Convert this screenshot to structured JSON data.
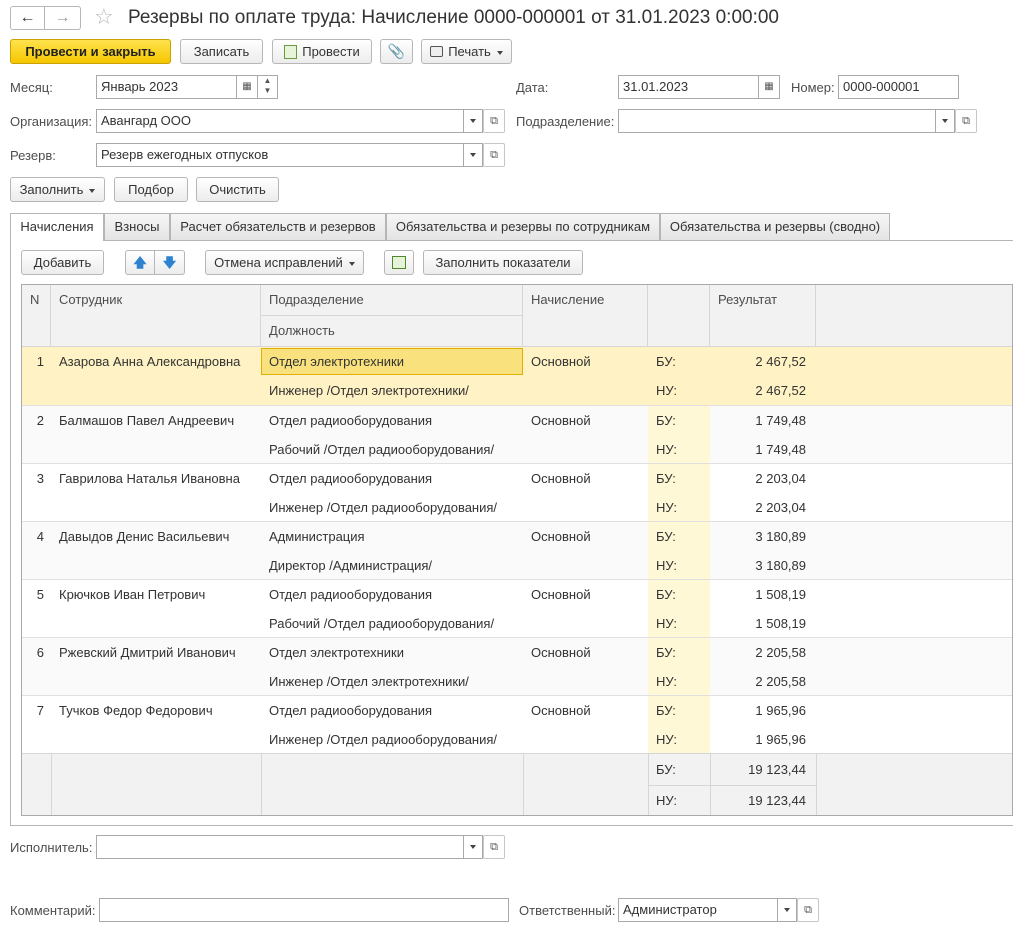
{
  "window": {
    "title": "Резервы по оплате труда: Начисление 0000-000001 от 31.01.2023 0:00:00"
  },
  "toolbar": {
    "post_close": "Провести и закрыть",
    "save": "Записать",
    "post": "Провести",
    "print": "Печать"
  },
  "form": {
    "month_label": "Месяц:",
    "month_value": "Январь 2023",
    "date_label": "Дата:",
    "date_value": "31.01.2023",
    "number_label": "Номер:",
    "number_value": "0000-000001",
    "org_label": "Организация:",
    "org_value": "Авангард ООО",
    "division_label": "Подразделение:",
    "division_value": "",
    "reserve_label": "Резерв:",
    "reserve_value": "Резерв ежегодных отпусков"
  },
  "actions": {
    "fill": "Заполнить",
    "select": "Подбор",
    "clear": "Очистить"
  },
  "tabs": [
    {
      "label": "Начисления"
    },
    {
      "label": "Взносы"
    },
    {
      "label": "Расчет обязательств и резервов"
    },
    {
      "label": "Обязательства и резервы по сотрудникам"
    },
    {
      "label": "Обязательства и резервы (сводно)"
    }
  ],
  "table_toolbar": {
    "add": "Добавить",
    "cancel_fix": "Отмена исправлений",
    "fill_indicators": "Заполнить показатели"
  },
  "table": {
    "headers": {
      "n": "N",
      "employee": "Сотрудник",
      "division": "Подразделение",
      "position": "Должность",
      "accrual": "Начисление",
      "result": "Результат"
    },
    "bu_label": "БУ:",
    "nu_label": "НУ:",
    "rows": [
      {
        "n": "1",
        "employee": "Азарова Анна Александровна",
        "division": "Отдел электротехники",
        "position": "Инженер /Отдел электротехники/",
        "accrual": "Основной",
        "bu": "2 467,52",
        "nu": "2 467,52"
      },
      {
        "n": "2",
        "employee": "Балмашов Павел Андреевич",
        "division": "Отдел радиооборудования",
        "position": "Рабочий /Отдел радиооборудования/",
        "accrual": "Основной",
        "bu": "1 749,48",
        "nu": "1 749,48"
      },
      {
        "n": "3",
        "employee": "Гаврилова Наталья Ивановна",
        "division": "Отдел радиооборудования",
        "position": "Инженер /Отдел радиооборудования/",
        "accrual": "Основной",
        "bu": "2 203,04",
        "nu": "2 203,04"
      },
      {
        "n": "4",
        "employee": "Давыдов Денис Васильевич",
        "division": "Администрация",
        "position": "Директор /Администрация/",
        "accrual": "Основной",
        "bu": "3 180,89",
        "nu": "3 180,89"
      },
      {
        "n": "5",
        "employee": "Крючков Иван Петрович",
        "division": "Отдел радиооборудования",
        "position": "Рабочий /Отдел радиооборудования/",
        "accrual": "Основной",
        "bu": "1 508,19",
        "nu": "1 508,19"
      },
      {
        "n": "6",
        "employee": "Ржевский Дмитрий Иванович",
        "division": "Отдел электротехники",
        "position": "Инженер /Отдел электротехники/",
        "accrual": "Основной",
        "bu": "2 205,58",
        "nu": "2 205,58"
      },
      {
        "n": "7",
        "employee": "Тучков Федор Федорович",
        "division": "Отдел радиооборудования",
        "position": "Инженер /Отдел радиооборудования/",
        "accrual": "Основной",
        "bu": "1 965,96",
        "nu": "1 965,96"
      }
    ],
    "totals": {
      "bu": "19 123,44",
      "nu": "19 123,44"
    }
  },
  "footer": {
    "executor_label": "Исполнитель:",
    "executor_value": "",
    "comment_label": "Комментарий:",
    "comment_value": "",
    "responsible_label": "Ответственный:",
    "responsible_value": "Администратор"
  },
  "colors": {
    "primary_button": "#f5c600",
    "selected_row": "#fff2c4",
    "bu_column": "#fff8d6"
  }
}
